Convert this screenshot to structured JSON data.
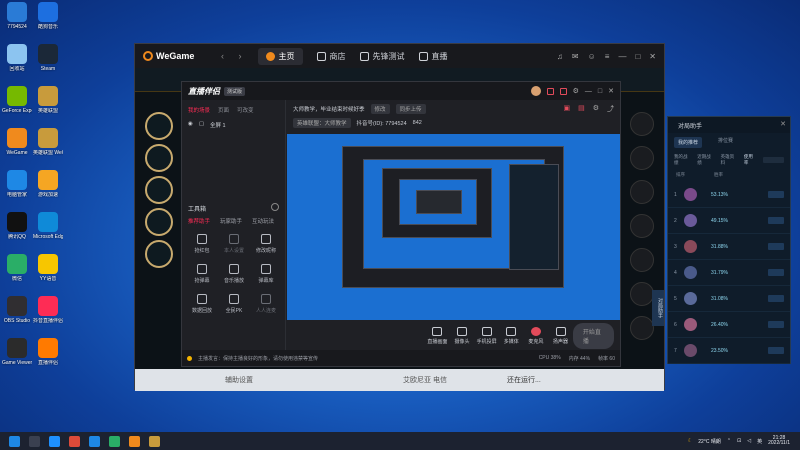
{
  "desktop": {
    "icons": [
      {
        "label": "7794524",
        "color": "#2a7bd6"
      },
      {
        "label": "酷狗音乐",
        "color": "#1d6fe0"
      },
      {
        "label": "回收站",
        "color": "#8cc4f0"
      },
      {
        "label": "Steam",
        "color": "#1b2838"
      },
      {
        "label": "GeForce Experience",
        "color": "#76b900"
      },
      {
        "label": "英雄联盟",
        "color": "#c89b3c"
      },
      {
        "label": "WeGame",
        "color": "#f08a1d"
      },
      {
        "label": "英雄联盟 WeGame版",
        "color": "#c89b3c"
      },
      {
        "label": "电脑管家",
        "color": "#1e88e5"
      },
      {
        "label": "游戏加速",
        "color": "#f5a623"
      },
      {
        "label": "腾讯QQ",
        "color": "#111111"
      },
      {
        "label": "Microsoft Edge",
        "color": "#0f8ad8"
      },
      {
        "label": "微信",
        "color": "#2aae67"
      },
      {
        "label": "YY语音",
        "color": "#f7c600"
      },
      {
        "label": "OBS Studio",
        "color": "#302e31"
      },
      {
        "label": "抖音直播伴侣",
        "color": "#fe2c55"
      },
      {
        "label": "Game Viewer",
        "color": "#2b2b2b"
      },
      {
        "label": "直播伴侣",
        "color": "#ff7a00"
      }
    ]
  },
  "wegame": {
    "logo": "WeGame",
    "nav": [
      {
        "label": "主页",
        "active": true
      },
      {
        "label": "商店",
        "active": false
      },
      {
        "label": "先锋测试",
        "active": false
      },
      {
        "label": "直播",
        "active": false
      }
    ],
    "bottom_items": [
      "辅助设置",
      "艾欧尼亚 电信",
      "还在运行..."
    ]
  },
  "zhibo": {
    "logo": "直播伴侣",
    "badge": "测试版",
    "left_tabs": [
      "我的场景",
      "页面",
      "可改变"
    ],
    "scene_label": "全屏 1",
    "tools_title": "工具箱",
    "sub_tabs": [
      "推荐助手",
      "玩家助手",
      "互动玩法"
    ],
    "tools": [
      {
        "label": "抢红包",
        "dim": false
      },
      {
        "label": "本人设置",
        "dim": true
      },
      {
        "label": "修改昵称",
        "dim": false
      },
      {
        "label": "抢弹幕",
        "dim": false
      },
      {
        "label": "音乐播放",
        "dim": false
      },
      {
        "label": "弹幕库",
        "dim": false
      },
      {
        "label": "数据回放",
        "dim": false
      },
      {
        "label": "全民PK",
        "dim": false
      },
      {
        "label": "人人连麦",
        "dim": true
      }
    ],
    "info_line1": "大师教学，毕业结束时候好季",
    "info_tag1": "修改",
    "info_tag2": "同步上传",
    "info_line2_a": "英雄联盟：大师教学",
    "info_line2_b": "抖音号(ID): 7794524",
    "info_count": "842",
    "bottom_tools": [
      {
        "label": "直播画面",
        "red": false
      },
      {
        "label": "摄像头",
        "red": false
      },
      {
        "label": "手机投屏",
        "red": false
      },
      {
        "label": "多媒体",
        "red": false
      },
      {
        "label": "麦克风",
        "red": true
      },
      {
        "label": "扬声器",
        "red": false
      }
    ],
    "start_button": "开始直播",
    "status_text": "主播发言：保持主播良好的形象，请勿使用违禁等宣传",
    "status_stats": [
      "CPU 38%",
      "内存 44%",
      "帧率 60"
    ]
  },
  "helper": {
    "title": "对局助手",
    "tabs": [
      "我的推荐",
      "排位赛"
    ],
    "sub_tabs": [
      "我的战绩",
      "近期战绩",
      "英雄资料",
      "使用率"
    ],
    "head_num": "排序",
    "head_rate": "胜率",
    "rows": [
      {
        "num": "1",
        "pct": "53.13%"
      },
      {
        "num": "2",
        "pct": "49.15%"
      },
      {
        "num": "3",
        "pct": "31.88%"
      },
      {
        "num": "4",
        "pct": "31.79%"
      },
      {
        "num": "5",
        "pct": "31.08%"
      },
      {
        "num": "6",
        "pct": "26.40%"
      },
      {
        "num": "7",
        "pct": "23.50%"
      }
    ],
    "side_tab": "对局助手"
  },
  "taskbar": {
    "apps": [
      "#1e90ff",
      "#dd4b39",
      "#1e88e5",
      "#2aae67",
      "#f08a1d",
      "#c89b3c"
    ],
    "weather": "22°C 晴朗",
    "time": "21:28",
    "date": "2022/11/1"
  }
}
